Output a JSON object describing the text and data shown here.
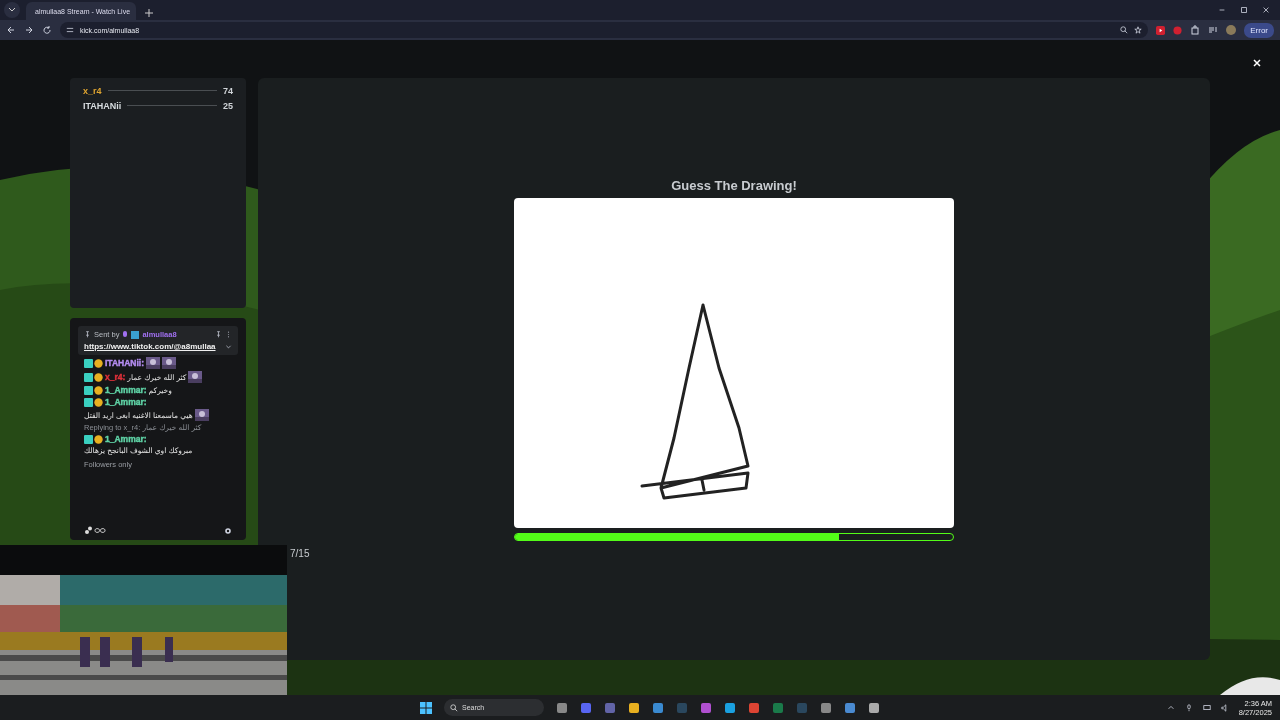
{
  "browser": {
    "tab_title": "almullaa8 Stream - Watch Live",
    "url": "kick.com/almullaa8",
    "profile_button": "Error"
  },
  "leaderboard": [
    {
      "name": "x_r4",
      "score": "74",
      "color": "#e0a530"
    },
    {
      "name": "ITAHANii",
      "score": "25",
      "color": "#d8dde0"
    }
  ],
  "chat": {
    "pinned": {
      "sent_by": "Sent by",
      "author": "almullaa8",
      "link": "https://www.tiktok.com/@a8mullaa"
    },
    "messages": [
      {
        "user": "ITAHANii:",
        "color": "#b48cf0"
      },
      {
        "user": "x_r4:",
        "color": "#e0303a",
        "text": "كثر الله خيرك عمار"
      },
      {
        "user": "1_Ammar:",
        "color": "#5fd3a6",
        "text": "وخيركم"
      },
      {
        "user": "1_Ammar:",
        "color": "#5fd3a6",
        "text": "هيي ماسمعنا الاغنيه ابغى اريد القتل"
      },
      {
        "user": "1_Ammar:",
        "color": "#5fd3a6",
        "reply": "Replying to x_r4: كثر الله خيرك عمار",
        "text": "مبروكك اوي الشوف البانجح يزهالك"
      }
    ],
    "mode": "Followers only"
  },
  "game": {
    "title": "Guess The Drawing!",
    "level": 0.74,
    "round": "7/15"
  },
  "taskbar": {
    "search_placeholder": "Search",
    "time": "2:36 AM",
    "date": "8/27/2025"
  }
}
